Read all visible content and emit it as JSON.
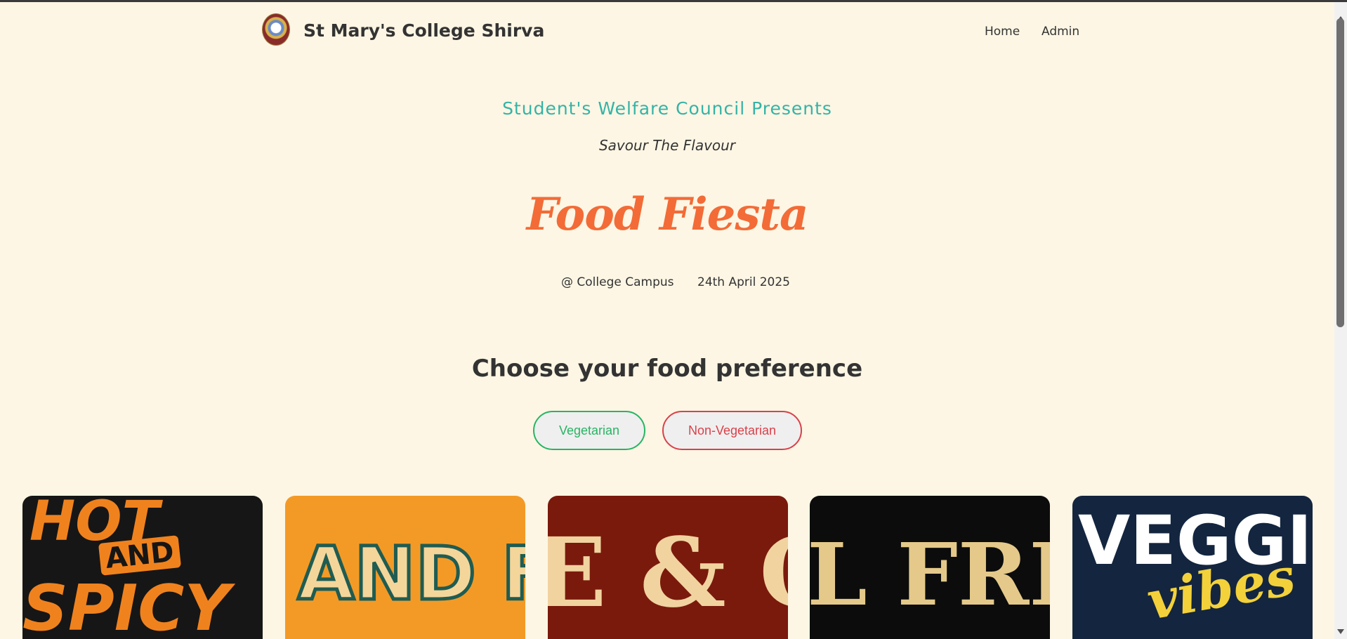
{
  "header": {
    "site_title": "St Mary's College Shirva",
    "logo_icon": "college-crest-icon",
    "nav": {
      "home": "Home",
      "admin": "Admin"
    }
  },
  "hero": {
    "presents": "Student's Welfare Council Presents",
    "tagline": "Savour The Flavour",
    "event_title": "Food Fiesta",
    "location": "@ College Campus",
    "date": "24th April 2025"
  },
  "preference": {
    "heading": "Choose your food preference",
    "vegetarian": "Vegetarian",
    "non_vegetarian": "Non-Vegetarian"
  },
  "cards": [
    {
      "line1": "HOT",
      "line2": "AND",
      "line3": "SPICY"
    },
    {
      "text": "AND F"
    },
    {
      "text": "E & C"
    },
    {
      "text": "L FRI"
    },
    {
      "line1": "VEGGIE",
      "line2": "vibes"
    }
  ],
  "colors": {
    "background": "#fdf6e4",
    "accent_teal": "#35b3a6",
    "title_orange": "#f36b37",
    "veg_green": "#28b463",
    "nonveg_red": "#d9414a"
  }
}
